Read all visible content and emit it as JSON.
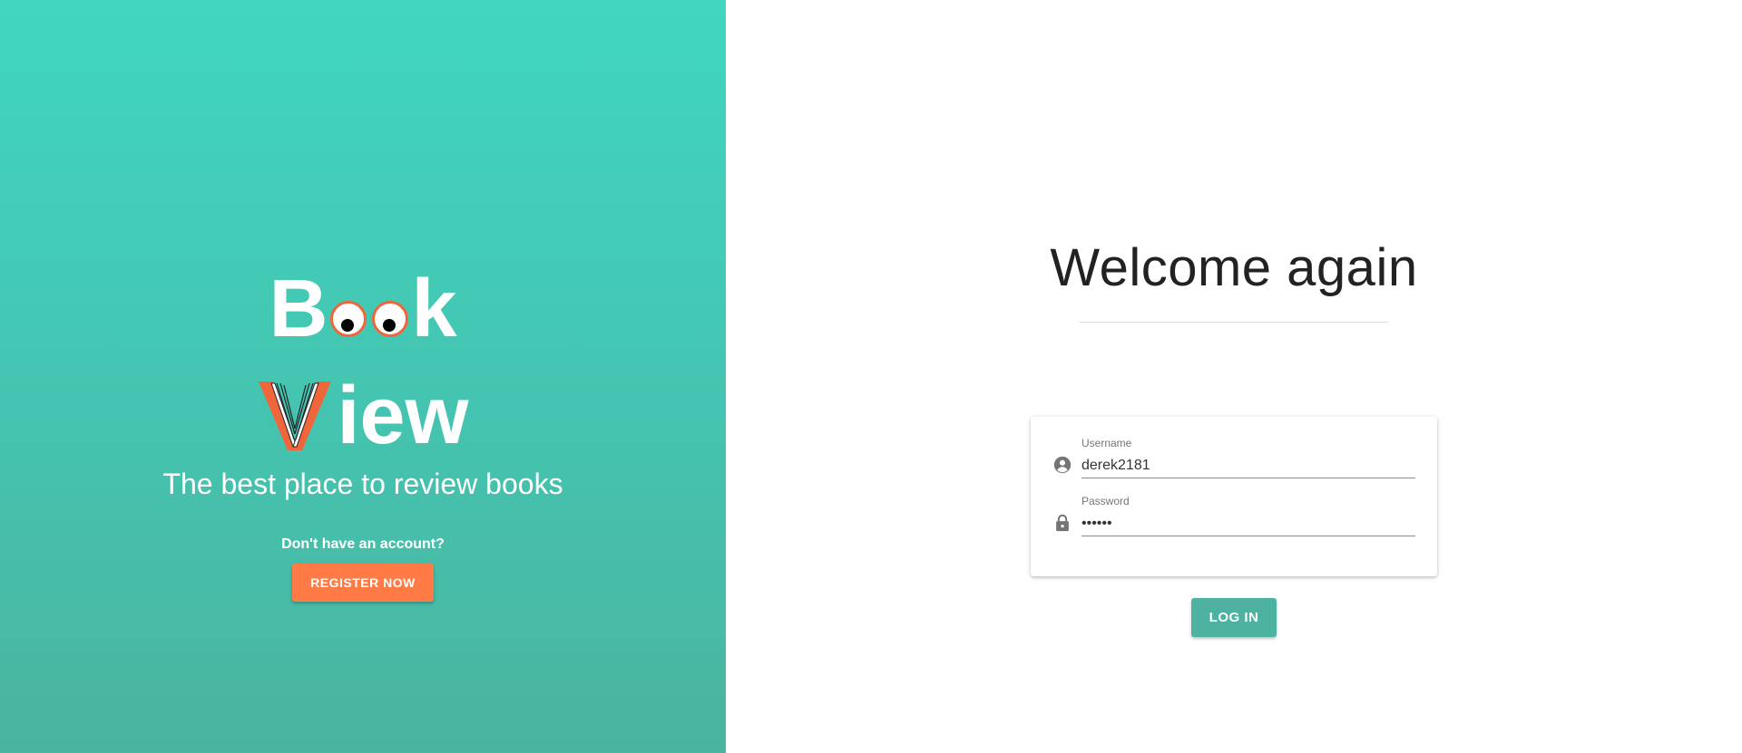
{
  "brand": {
    "logo_line1_start": "B",
    "logo_line1_end": "k",
    "logo_line2_end": "iew",
    "tagline": "The best place to review books",
    "colors": {
      "panel_top": "#40d6c0",
      "panel_bottom": "#4ab49f",
      "accent": "#ff7a45"
    }
  },
  "signup": {
    "prompt": "Don't have an account?",
    "register_label": "REGISTER NOW"
  },
  "login": {
    "title": "Welcome again",
    "username_label": "Username",
    "username_value": "derek2181",
    "username_icon": "account-circle-icon",
    "password_label": "Password",
    "password_value": "••••••",
    "password_icon": "lock-icon",
    "login_label": "LOG IN",
    "colors": {
      "button": "#4db3a0"
    }
  }
}
